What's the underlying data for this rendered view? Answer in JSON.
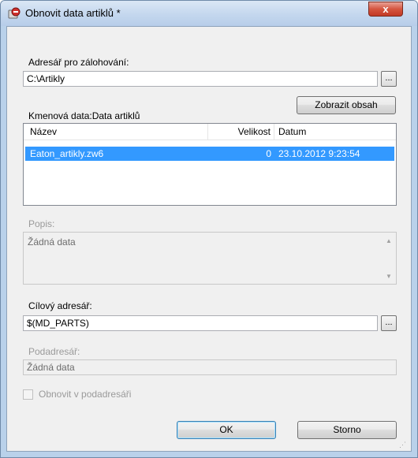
{
  "window": {
    "title": "Obnovit data artiklů *",
    "close_label": "x"
  },
  "backup_dir": {
    "label": "Adresář pro zálohování:",
    "value": "C:\\Artikly",
    "browse_label": "..."
  },
  "show_content_button": "Zobrazit obsah",
  "master_data": {
    "label": "Kmenová data:Data artiklů",
    "columns": [
      "Název",
      "Velikost",
      "Datum"
    ],
    "rows": [
      {
        "name": "Eaton_artikly.zw6",
        "size": "0",
        "date": "23.10.2012 9:23:54",
        "selected": true
      }
    ]
  },
  "description": {
    "label": "Popis:",
    "value": "Žádná data"
  },
  "target_dir": {
    "label": "Cílový adresář:",
    "value": "$(MD_PARTS)",
    "browse_label": "..."
  },
  "subdirectory": {
    "label": "Podadresář:",
    "value": "Žádná data"
  },
  "restore_in_subdir": {
    "label": "Obnovit v podadresáři",
    "checked": false
  },
  "buttons": {
    "ok": "OK",
    "cancel": "Storno"
  },
  "colors": {
    "selection": "#3399ff",
    "window_frame": "#b9d1ea",
    "close_button": "#c94a35"
  }
}
